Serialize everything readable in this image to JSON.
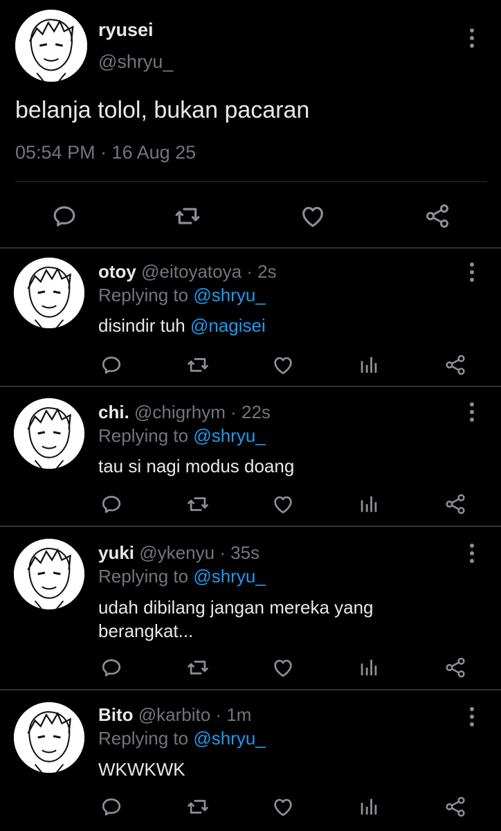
{
  "main_tweet": {
    "display_name": "ryusei",
    "handle": "@shryu_",
    "text": "belanja tolol, bukan pacaran",
    "timestamp": "05:54 PM · 16 Aug 25",
    "avatar": "manga-character-avatar",
    "actions": [
      "reply-icon",
      "retweet-icon",
      "like-icon",
      "share-icon"
    ]
  },
  "replies": [
    {
      "display_name": "otoy",
      "meta": "@eitoyatoya · 2s",
      "replying_prefix": "Replying to",
      "replying_to": "@shryu_",
      "text_prefix": "disindir tuh",
      "text_mention": "@nagisei",
      "avatar": "manga-character-avatar"
    },
    {
      "display_name": "chi.",
      "meta": "@chigrhym · 22s",
      "replying_prefix": "Replying to",
      "replying_to": "@shryu_",
      "text": "tau si nagi modus doang",
      "avatar": "manga-character-avatar"
    },
    {
      "display_name": "yuki",
      "meta": "@ykenyu · 35s",
      "replying_prefix": "Replying to",
      "replying_to": "@shryu_",
      "text": "udah dibilang jangan mereka yang berangkat...",
      "avatar": "manga-character-avatar"
    },
    {
      "display_name": "Bito",
      "meta": "@karbito · 1m",
      "replying_prefix": "Replying to",
      "replying_to": "@shryu_",
      "text": "WKWKWK",
      "avatar": "manga-character-avatar"
    }
  ],
  "reply_actions": [
    "reply-icon",
    "retweet-icon",
    "like-icon",
    "views-icon",
    "share-icon"
  ],
  "colors": {
    "background": "#000000",
    "text_primary": "#e7e9ea",
    "text_secondary": "#71767b",
    "accent": "#1d9bf0",
    "divider": "#2f3336"
  }
}
